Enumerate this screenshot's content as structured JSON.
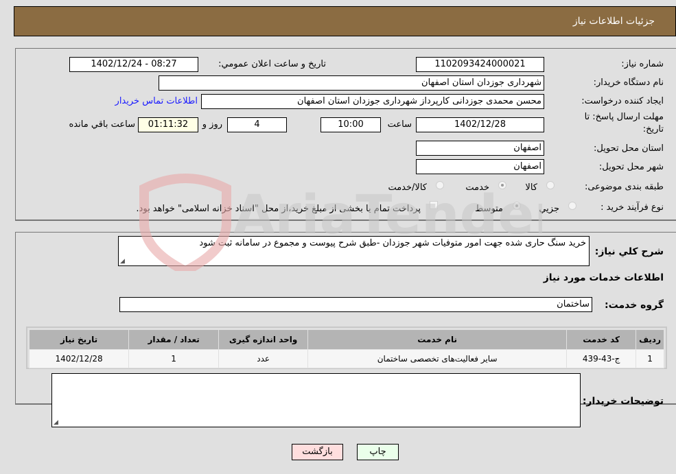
{
  "header": {
    "title": "جزئیات اطلاعات نیاز"
  },
  "details": {
    "need_number_label": "شماره نیاز:",
    "need_number": "1102093424000021",
    "announce_label": "تاریخ و ساعت اعلان عمومي:",
    "announce_value": "1402/12/24 - 08:27",
    "buyer_org_label": "نام دستگاه خریدار:",
    "buyer_org": "شهرداری جوزدان استان اصفهان",
    "creator_label": "ایجاد کننده درخواست:",
    "creator": "محسن محمدی جوزدانی کارپرداز شهرداری جوزدان استان اصفهان",
    "contact_link": "اطلاعات تماس خریدار",
    "deadline_label_line1": "مهلت ارسال پاسخ: تا",
    "deadline_label_line2": "تاریخ:",
    "deadline_date": "1402/12/28",
    "time_label": "ساعت",
    "deadline_time": "10:00",
    "days_value": "4",
    "days_label": "روز و",
    "remaining_time": "01:11:32",
    "remaining_label": "ساعت باقي مانده",
    "province_label": "استان محل تحویل:",
    "province": "اصفهان",
    "city_label": "شهر محل تحویل:",
    "city": "اصفهان",
    "category_label": "طبقه بندی موضوعی:",
    "category_options": [
      {
        "label": "کالا",
        "checked": false
      },
      {
        "label": "خدمت",
        "checked": true
      },
      {
        "label": "کالا/خدمت",
        "checked": false
      }
    ],
    "process_label": "نوع فرآیند خرید :",
    "process_options": [
      {
        "label": "جزيي",
        "checked": false
      },
      {
        "label": "متوسط",
        "checked": true
      }
    ],
    "treasury_note": "پرداخت تمام یا بخشی از مبلغ خرید،از محل \"اسناد خزانه اسلامی\" خواهد بود.",
    "treasury_checked": false
  },
  "services": {
    "summary_label": "شرح کلي نیاز:",
    "summary": "خرید سنگ حاری شده جهت امور متوفیات شهر جوزدان -طبق شرح پیوست و مجموع در سامانه ثبت شود",
    "section_title": "اطلاعات خدمات مورد نیاز",
    "group_label": "گروه خدمت:",
    "group_value": "ساختمان",
    "table": {
      "headers": [
        "ردیف",
        "کد خدمت",
        "نام خدمت",
        "واحد اندازه گیری",
        "تعداد / مقدار",
        "تاریخ نیاز"
      ],
      "rows": [
        [
          "1",
          "ج-43-439",
          "سایر فعالیت‌های تخصصی ساختمان",
          "عدد",
          "1",
          "1402/12/28"
        ]
      ]
    },
    "buyer_notes_label": "توضیحات خریدار:",
    "buyer_notes": ""
  },
  "buttons": {
    "print": "چاپ",
    "back": "بازگشت"
  },
  "watermark": {
    "text": "AriaTender.neT"
  }
}
